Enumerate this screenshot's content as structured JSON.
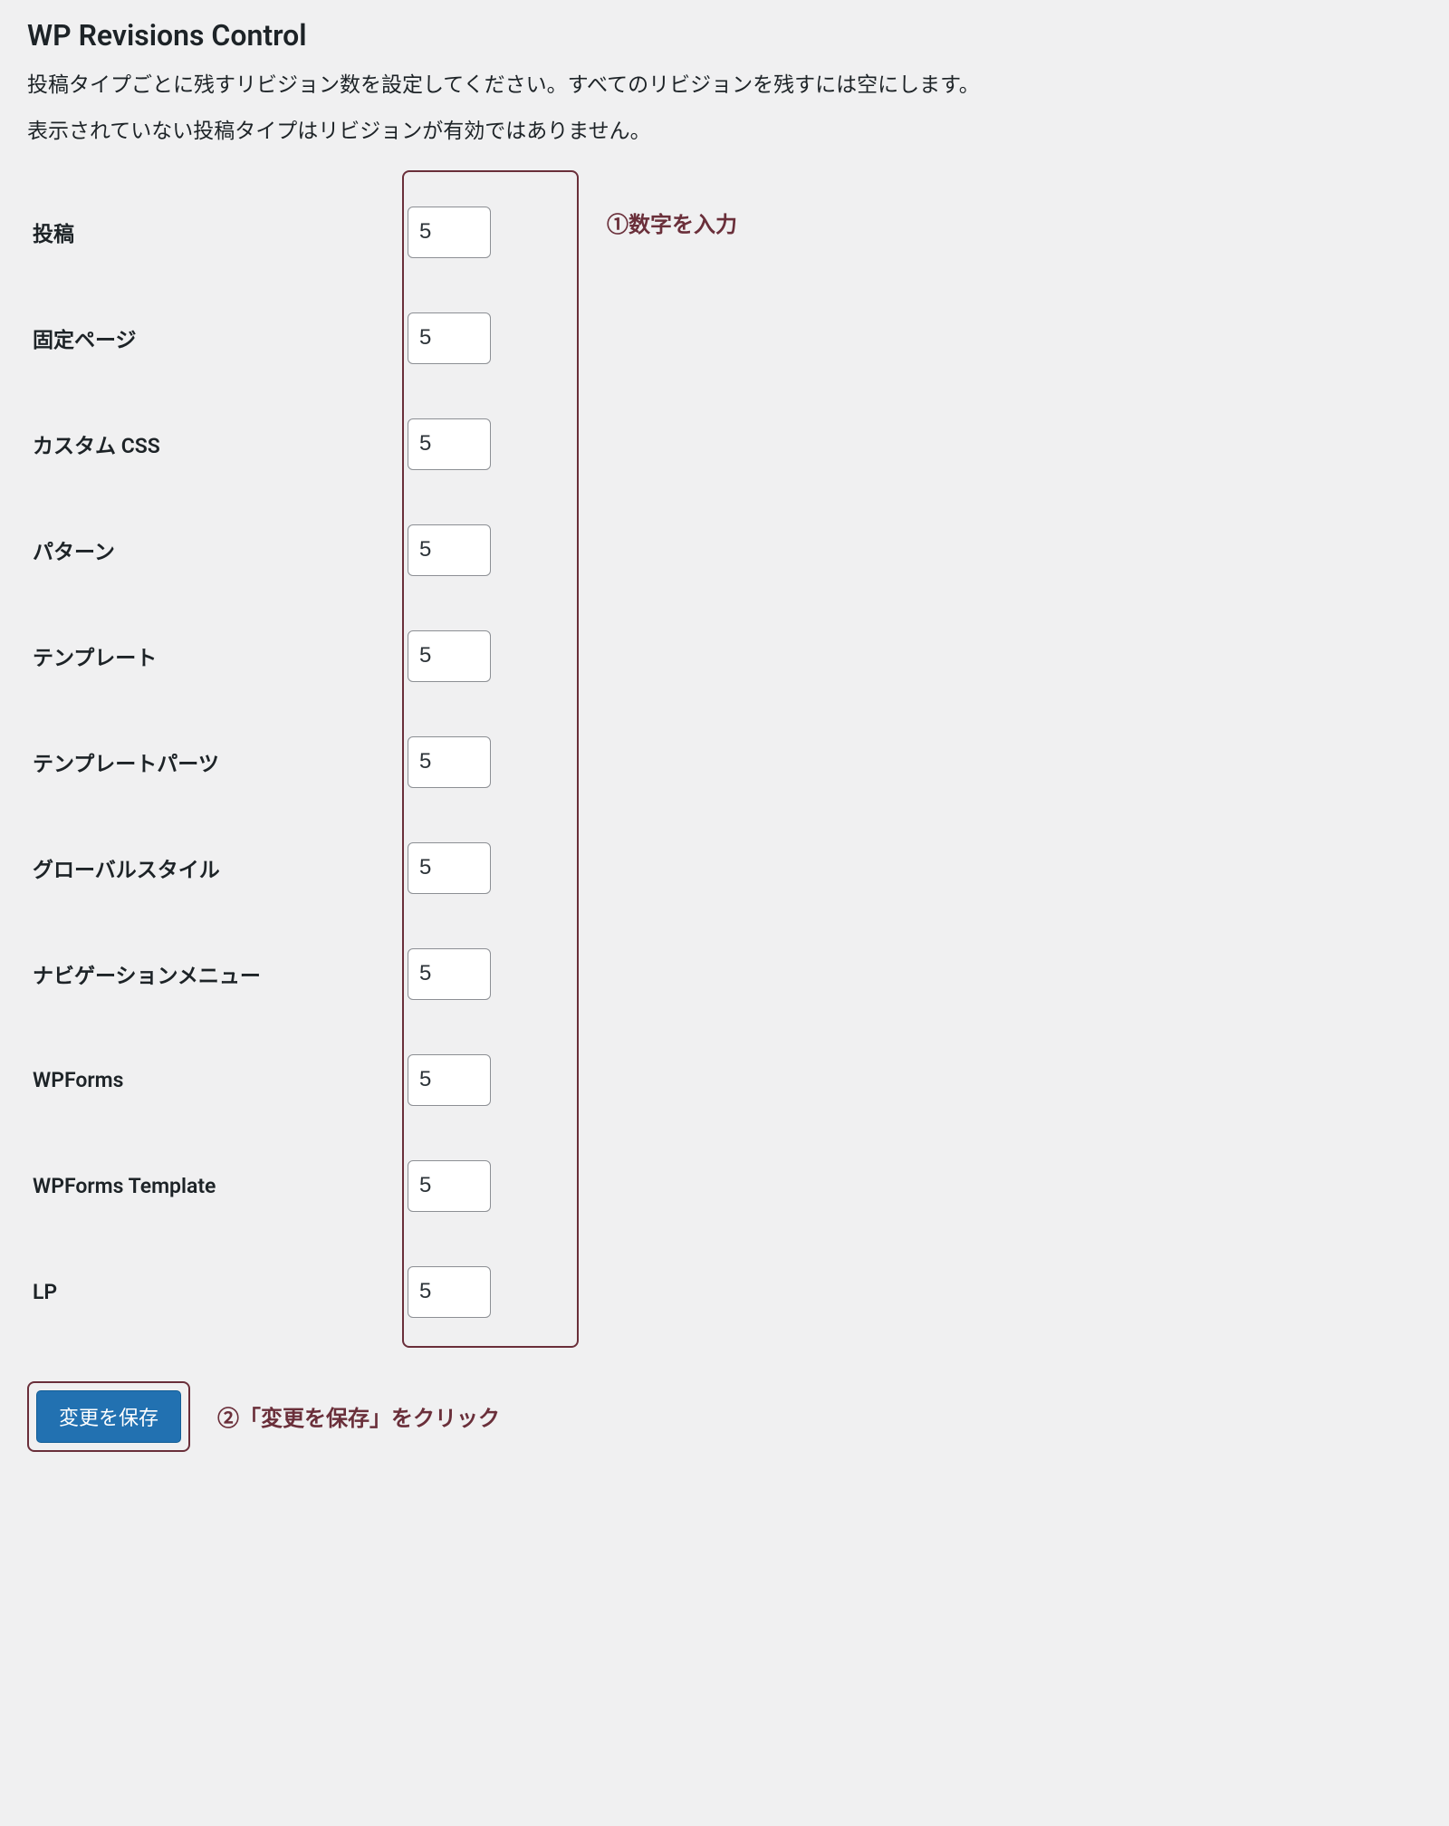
{
  "section": {
    "title": "WP Revisions Control",
    "description1": "投稿タイプごとに残すリビジョン数を設定してください。すべてのリビジョンを残すには空にします。",
    "description2": "表示されていない投稿タイプはリビジョンが有効ではありません。"
  },
  "post_types": [
    {
      "label": "投稿",
      "value": "5"
    },
    {
      "label": "固定ページ",
      "value": "5"
    },
    {
      "label": "カスタム CSS",
      "value": "5"
    },
    {
      "label": "パターン",
      "value": "5"
    },
    {
      "label": "テンプレート",
      "value": "5"
    },
    {
      "label": "テンプレートパーツ",
      "value": "5"
    },
    {
      "label": "グローバルスタイル",
      "value": "5"
    },
    {
      "label": "ナビゲーションメニュー",
      "value": "5"
    },
    {
      "label": "WPForms",
      "value": "5"
    },
    {
      "label": "WPForms Template",
      "value": "5"
    },
    {
      "label": "LP",
      "value": "5"
    }
  ],
  "annotations": {
    "input_hint": "①数字を入力",
    "save_hint": "②「変更を保存」をクリック"
  },
  "buttons": {
    "save": "変更を保存"
  }
}
